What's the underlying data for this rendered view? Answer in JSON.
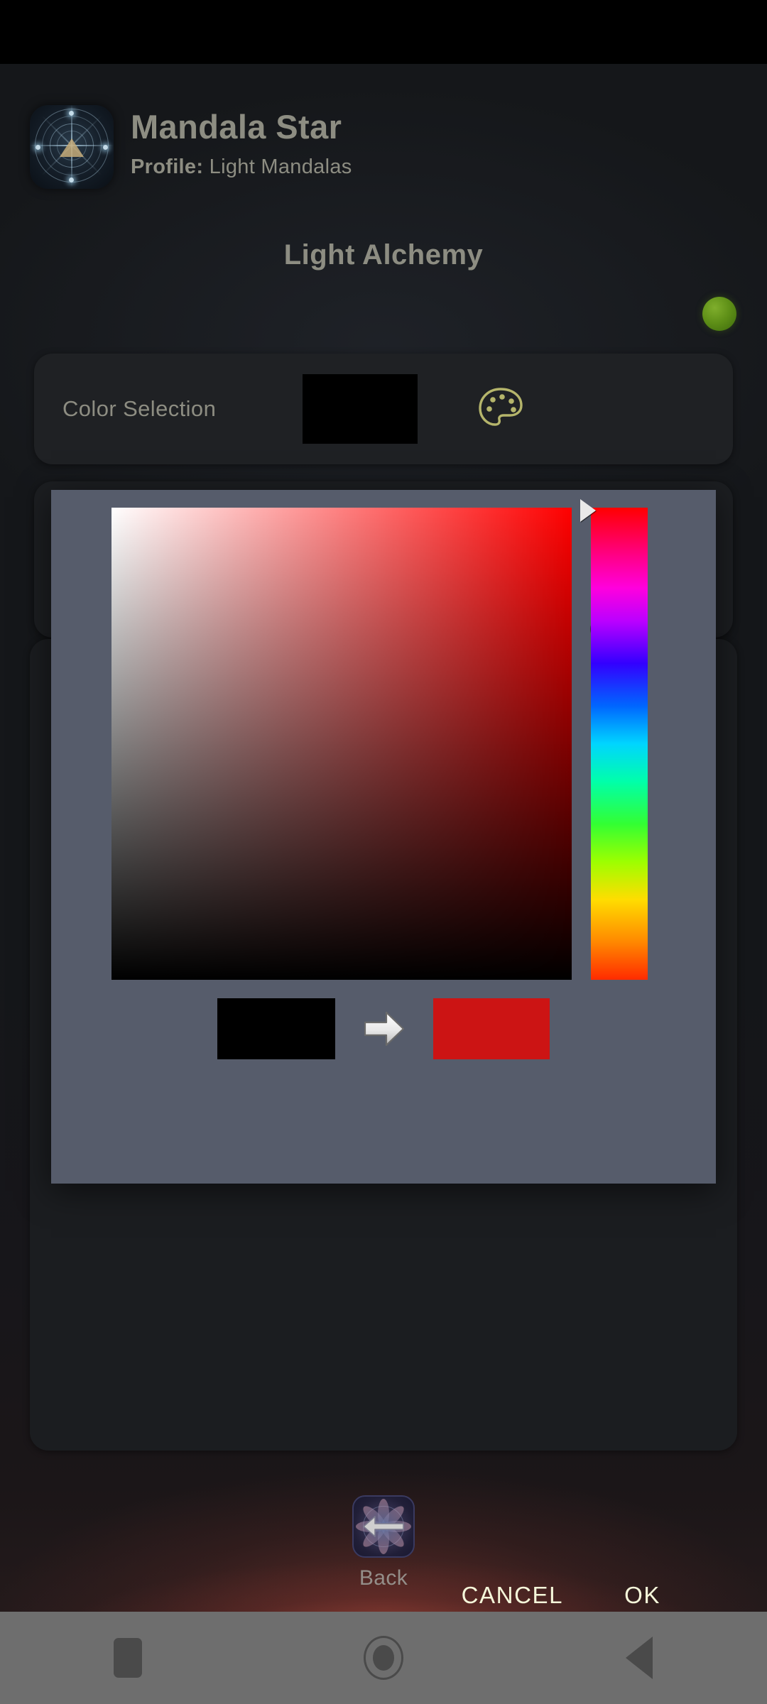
{
  "app": {
    "title": "Mandala Star",
    "profile_label": "Profile:",
    "profile_value": "Light Mandalas",
    "icon_name": "mandala-star-app-icon"
  },
  "screen": {
    "title": "Light Alchemy",
    "status_indicator_color": "#5e8f17"
  },
  "color_selection": {
    "label": "Color Selection",
    "current_color": "#000000",
    "palette_icon": "palette-icon",
    "palette_icon_color": "#b5b56b"
  },
  "color_picker_dialog": {
    "dialog_background": "#565c6b",
    "base_hue_color": "#ff0000",
    "old_color": "#000000",
    "new_color": "#cc1414",
    "arrow_icon": "right-arrow-icon",
    "cancel_label": "CANCEL",
    "ok_label": "OK",
    "button_text_color": "#f5f7da",
    "hue_handle_icon": "hue-slider-handle",
    "sv_cursor_icon": "saturation-value-cursor",
    "hue_stops": [
      "#ff0000",
      "#ff0077",
      "#ff00dd",
      "#bb00ff",
      "#3300ff",
      "#0066ff",
      "#00d5ff",
      "#00ffaa",
      "#33ff33",
      "#9dff00",
      "#ffdd00",
      "#ff8800",
      "#ff2b00"
    ]
  },
  "bottom_nav": {
    "back_label": "Back",
    "back_icon": "mandala-back-icon"
  },
  "system_nav": {
    "recents_icon": "square-recents-icon",
    "home_icon": "circle-home-icon",
    "back_icon": "triangle-back-icon"
  }
}
